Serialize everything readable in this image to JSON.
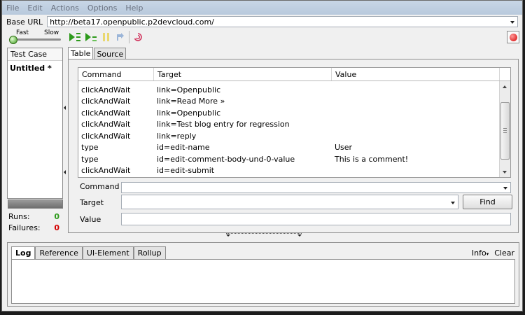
{
  "menu": [
    "File",
    "Edit",
    "Actions",
    "Options",
    "Help"
  ],
  "base_url": {
    "label": "Base URL",
    "value": "http://beta17.openpublic.p2devcloud.com/"
  },
  "speed": {
    "fast": "Fast",
    "slow": "Slow"
  },
  "icons": {
    "play_all": "play-all-icon",
    "play_current": "play-current-icon",
    "pause": "pause-icon",
    "step": "step-icon",
    "rollup": "rollup-icon",
    "record": "record-icon"
  },
  "colors": {
    "play": "#2e9a1c",
    "record": "#d40000",
    "pause": "#e9d870",
    "rollup": "#d0305a"
  },
  "test_case": {
    "header": "Test Case",
    "items": [
      "Untitled *"
    ]
  },
  "stats": {
    "runs_label": "Runs:",
    "runs": "0",
    "failures_label": "Failures:",
    "failures": "0"
  },
  "tabs": [
    "Table",
    "Source"
  ],
  "table": {
    "columns": [
      "Command",
      "Target",
      "Value"
    ],
    "rows": [
      {
        "command": "clickAndWait",
        "target": "link=Openpublic",
        "value": ""
      },
      {
        "command": "clickAndWait",
        "target": "link=Read More »",
        "value": ""
      },
      {
        "command": "clickAndWait",
        "target": "link=Openpublic",
        "value": ""
      },
      {
        "command": "clickAndWait",
        "target": "link=Test blog entry for regression",
        "value": ""
      },
      {
        "command": "clickAndWait",
        "target": "link=reply",
        "value": ""
      },
      {
        "command": "type",
        "target": "id=edit-name",
        "value": "User"
      },
      {
        "command": "type",
        "target": "id=edit-comment-body-und-0-value",
        "value": "This is a comment!"
      },
      {
        "command": "clickAndWait",
        "target": "id=edit-submit",
        "value": ""
      }
    ]
  },
  "form": {
    "command_label": "Command",
    "command_value": "",
    "target_label": "Target",
    "target_value": "",
    "value_label": "Value",
    "value_value": "",
    "find_label": "Find"
  },
  "bottom_tabs": [
    "Log",
    "Reference",
    "UI-Element",
    "Rollup"
  ],
  "bottom_actions": {
    "info": "Info",
    "clear": "Clear"
  }
}
